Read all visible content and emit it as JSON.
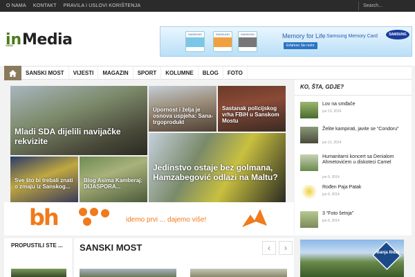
{
  "topnav": {
    "items": [
      "O NAMA",
      "KONTAKT",
      "PRAVILA I USLOVI KORIŠTENJA"
    ]
  },
  "search": {
    "placeholder": "Search..."
  },
  "logo": {
    "prefix": "in",
    "name": "Media",
    "tagline": "VAŠA"
  },
  "banner": {
    "title": "Memory for Life",
    "subtitle": "Samsung Memory Card",
    "cta": "Erfahren Sie mehr",
    "brand": "SAMSUNG",
    "cards": [
      "SAMSUNG",
      "SAMSUNG",
      "SAMSUNG"
    ]
  },
  "nav": {
    "items": [
      "SANSKI MOST",
      "VIJESTI",
      "MAGAZIN",
      "SPORT",
      "KOLUMNE",
      "BLOG",
      "FOTO"
    ]
  },
  "tiles": {
    "t1": "Mladi SDA dijelili navijačke rekvizite",
    "t2": "Upornost i želja je osnova uspjeha: Sana-trgoprodukt",
    "t3": "Sastanak policijskog vrha FBiH u Sanskom Mostu",
    "t4": "Jedinstvo ostaje bez golmana, Hamzabegović odlazi na Maltu?",
    "t5": "Sve što bi trebali znati o zmaju iz Sanskog...",
    "t6": "Blog Asima Kamberaj: DIJASPORA..."
  },
  "sidebar": {
    "title": "KO, ŠTA, GDJE?",
    "items": [
      {
        "title": "Lov na smđače",
        "date": "jun 13, 2014"
      },
      {
        "title": "Želite kampirati, javite se “Condoru”",
        "date": "jun 12, 2014"
      },
      {
        "title": "Humanitarni koncert sa Denialom Ahmetovićem u diskoteci Camel",
        "date": "jun 9, 2014"
      },
      {
        "title": "Rođen Paja Patak",
        "date": "jun 9, 2014"
      },
      {
        "title": "3 “Foto šetnja”",
        "date": "jun 6, 2014"
      }
    ],
    "ad_text": "Banja Ilidža"
  },
  "ad": {
    "brand": "bh",
    "slogan": "idemo prvi ... dajemo više!"
  },
  "bottom": {
    "left_title": "PROPUSTILI STE ...",
    "section_title": "SANSKI MOST",
    "prev": "‹",
    "next": "›"
  },
  "colors": {
    "accent": "#8a7a5c",
    "logo_green": "#4d7a1a",
    "bh_orange": "#f07a1c"
  }
}
